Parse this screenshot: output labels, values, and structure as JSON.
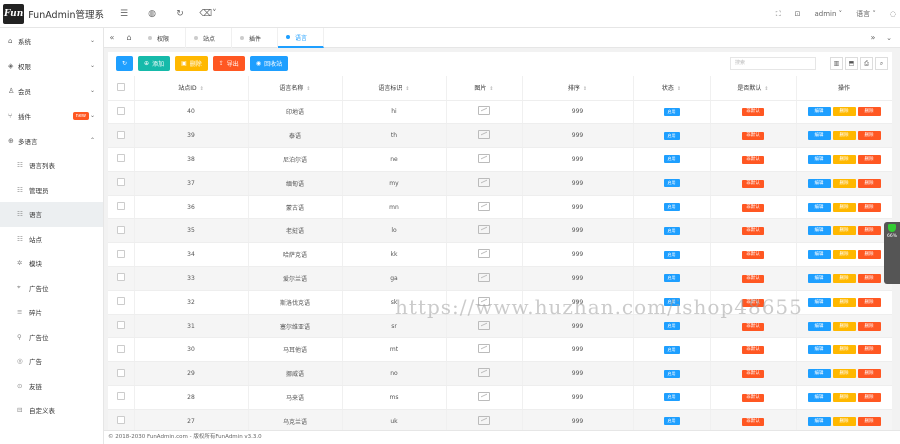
{
  "app": {
    "logo_mark": "Fun",
    "title": "FunAdmin管理系"
  },
  "header": {
    "user": "admin",
    "lang": "语言"
  },
  "sidebar": {
    "items": [
      {
        "label": "系统"
      },
      {
        "label": "权限"
      },
      {
        "label": "会员"
      },
      {
        "label": "插件",
        "badge": "new"
      },
      {
        "label": "多语言"
      }
    ],
    "sub_items": [
      {
        "label": "语言列表"
      },
      {
        "label": "管理员"
      },
      {
        "label": "语言"
      },
      {
        "label": "站点"
      },
      {
        "label": "模块"
      },
      {
        "label": "广告位"
      },
      {
        "label": "碎片"
      },
      {
        "label": "广告位"
      },
      {
        "label": "广告"
      },
      {
        "label": "友链"
      },
      {
        "label": "自定义表"
      }
    ]
  },
  "tabs": [
    {
      "label": "权限"
    },
    {
      "label": "站点"
    },
    {
      "label": "插件"
    },
    {
      "label": "语言"
    }
  ],
  "toolbar": {
    "add": "添加",
    "delete": "删除",
    "export": "导出",
    "recycle": "回收站",
    "search_placeholder": "搜索"
  },
  "table": {
    "headers": [
      "站点ID",
      "语言名称",
      "语言标识",
      "图片",
      "排序",
      "状态",
      "是否默认",
      "操作"
    ],
    "status_label": "启用",
    "default_label": "非默认",
    "ops": [
      "编辑",
      "删除",
      "删除"
    ],
    "rows": [
      {
        "id": "40",
        "name": "印地语",
        "code": "hi",
        "sort": "999"
      },
      {
        "id": "39",
        "name": "泰语",
        "code": "th",
        "sort": "999"
      },
      {
        "id": "38",
        "name": "尼泊尔语",
        "code": "ne",
        "sort": "999"
      },
      {
        "id": "37",
        "name": "缅甸语",
        "code": "my",
        "sort": "999"
      },
      {
        "id": "36",
        "name": "蒙古语",
        "code": "mn",
        "sort": "999"
      },
      {
        "id": "35",
        "name": "老挝语",
        "code": "lo",
        "sort": "999"
      },
      {
        "id": "34",
        "name": "哈萨克语",
        "code": "kk",
        "sort": "999"
      },
      {
        "id": "33",
        "name": "爱尔兰语",
        "code": "ga",
        "sort": "999"
      },
      {
        "id": "32",
        "name": "斯洛伐克语",
        "code": "sk",
        "sort": "999"
      },
      {
        "id": "31",
        "name": "塞尔维亚语",
        "code": "sr",
        "sort": "999"
      },
      {
        "id": "30",
        "name": "马耳他语",
        "code": "mt",
        "sort": "999"
      },
      {
        "id": "29",
        "name": "挪威语",
        "code": "no",
        "sort": "999"
      },
      {
        "id": "28",
        "name": "马来语",
        "code": "ms",
        "sort": "999"
      },
      {
        "id": "27",
        "name": "乌克兰语",
        "code": "uk",
        "sort": "999"
      }
    ]
  },
  "footer": {
    "text": "© 2018-2030 FunAdmin.com - 版权所有FunAdmin v3.3.0"
  },
  "float_widget": {
    "value": "66",
    "unit": "%"
  },
  "watermark": "https://www.huzhan.com/ishop48655"
}
